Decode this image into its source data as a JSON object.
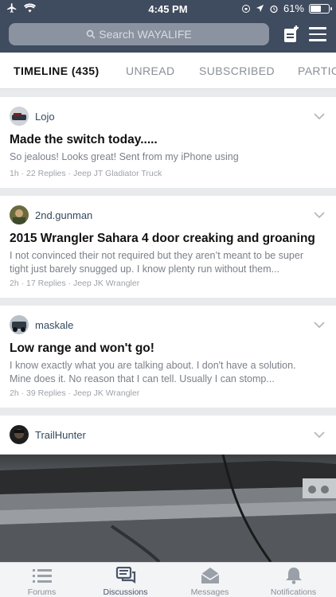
{
  "status_bar": {
    "time": "4:45 PM",
    "battery": "61%",
    "battery_level": 0.61
  },
  "header": {
    "search_placeholder": "Search WAYALIFE"
  },
  "tabs": [
    {
      "label": "TIMELINE (435)",
      "active": true
    },
    {
      "label": "UNREAD"
    },
    {
      "label": "SUBSCRIBED"
    },
    {
      "label": "PARTIC"
    }
  ],
  "posts": [
    {
      "author": "Lojo",
      "title": "Made the switch today.....",
      "snippet": "So jealous! Looks great! Sent from my iPhone using",
      "meta": "1h · 22 Replies · Jeep JT Gladiator Truck"
    },
    {
      "author": "2nd.gunman",
      "title": "2015 Wrangler Sahara 4 door creaking and groaning",
      "snippet": "I not convinced their not required but they aren’t meant to be super tight just barely snugged up. I know plenty run without them...",
      "meta": "2h · 17 Replies · Jeep JK Wrangler"
    },
    {
      "author": "maskale",
      "title": "Low range and won't go!",
      "snippet": "I know exactly what you are talking about. I don't have a solution. Mine does it. No reason that I can tell. Usually I can stomp...",
      "meta": "2h · 39 Replies · Jeep JK Wrangler"
    },
    {
      "author": "TrailHunter"
    }
  ],
  "bottom_nav": [
    {
      "label": "Forums",
      "icon": "list-icon"
    },
    {
      "label": "Discussions",
      "icon": "chat-bubbles-icon",
      "active": true
    },
    {
      "label": "Messages",
      "icon": "envelope-icon"
    },
    {
      "label": "Notifications",
      "icon": "bell-icon"
    }
  ]
}
